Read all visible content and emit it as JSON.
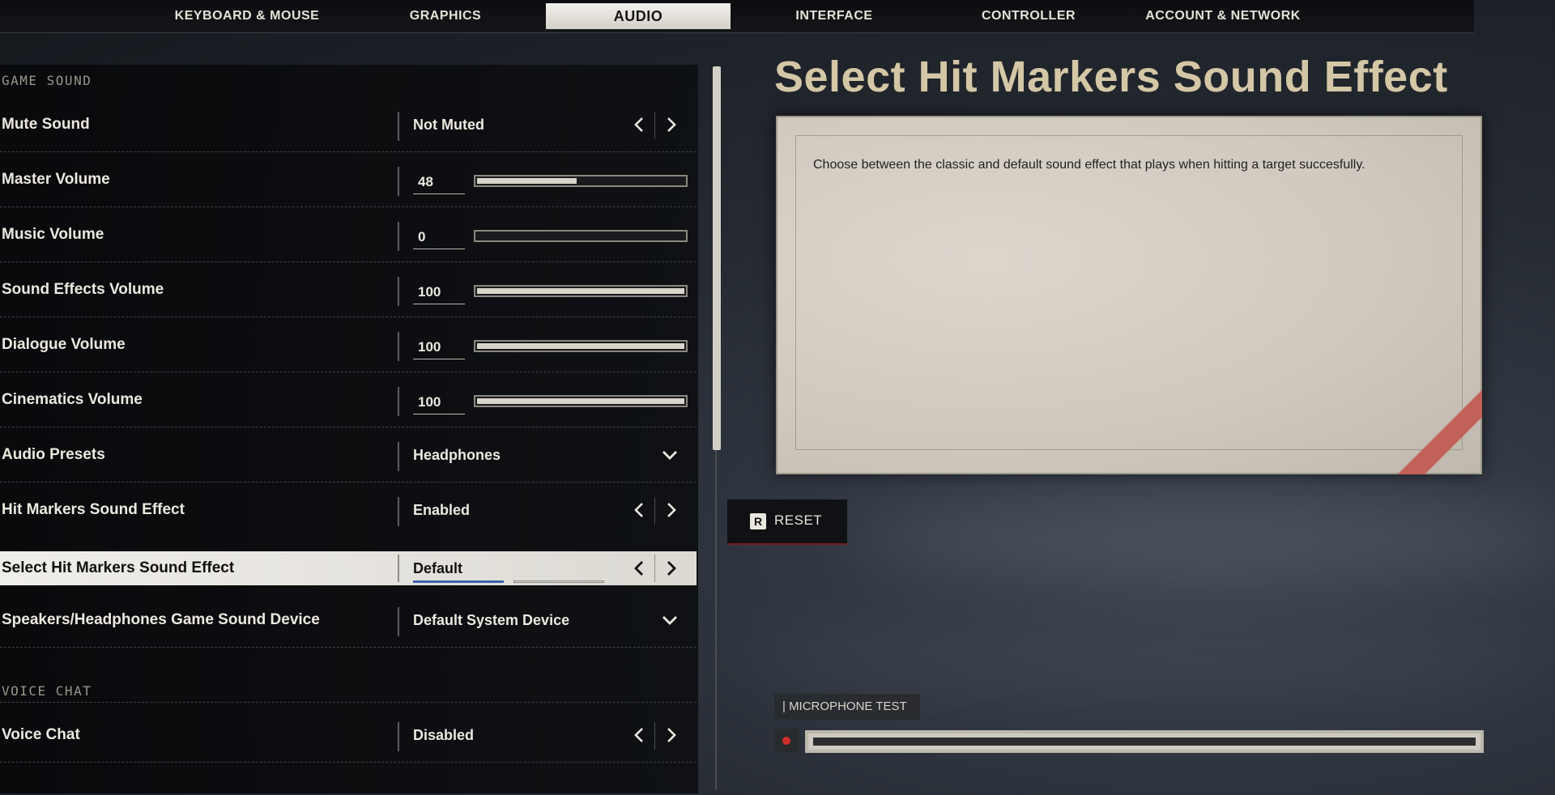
{
  "tabs": [
    {
      "label": "KEYBOARD & MOUSE"
    },
    {
      "label": "GRAPHICS"
    },
    {
      "label": "AUDIO",
      "active": true
    },
    {
      "label": "INTERFACE"
    },
    {
      "label": "CONTROLLER"
    },
    {
      "label": "ACCOUNT & NETWORK"
    }
  ],
  "sections": {
    "game_sound": "GAME SOUND",
    "voice_chat": "VOICE CHAT"
  },
  "settings": {
    "mute_sound": {
      "label": "Mute Sound",
      "value": "Not Muted"
    },
    "master_volume": {
      "label": "Master Volume",
      "value": "48",
      "level": 48
    },
    "music_volume": {
      "label": "Music Volume",
      "value": "0",
      "level": 0
    },
    "sfx_volume": {
      "label": "Sound Effects Volume",
      "value": "100",
      "level": 100
    },
    "dialogue_volume": {
      "label": "Dialogue Volume",
      "value": "100",
      "level": 100
    },
    "cinematics_volume": {
      "label": "Cinematics Volume",
      "value": "100",
      "level": 100
    },
    "audio_presets": {
      "label": "Audio Presets",
      "value": "Headphones"
    },
    "hit_markers": {
      "label": "Hit Markers Sound Effect",
      "value": "Enabled"
    },
    "select_hit_markers": {
      "label": "Select Hit Markers Sound Effect",
      "value": "Default"
    },
    "sound_device": {
      "label": "Speakers/Headphones Game Sound Device",
      "value": "Default System Device"
    },
    "voice_chat": {
      "label": "Voice Chat",
      "value": "Disabled"
    }
  },
  "detail": {
    "title": "Select Hit Markers Sound Effect",
    "description": "Choose between the classic and default sound effect that plays when hitting a target succesfully."
  },
  "reset": {
    "key": "R",
    "label": "RESET"
  },
  "microphone": {
    "label": "| MICROPHONE TEST"
  },
  "colors": {
    "accent_blue": "#3a63a8",
    "reset_red": "#7a1c1c",
    "title_gold": "#d4c7a6"
  }
}
